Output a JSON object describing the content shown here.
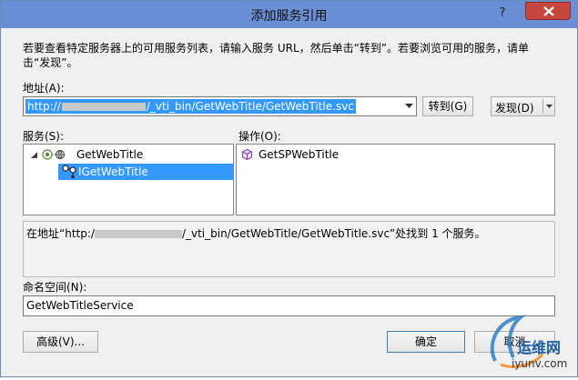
{
  "window": {
    "title": "添加服务引用",
    "help_label": "?"
  },
  "intro": {
    "text": "若要查看特定服务器上的可用服务列表，请输入服务 URL，然后单击“转到”。若要浏览可用的服务，请单击“发现”。"
  },
  "address": {
    "label": "地址(A):",
    "value_start": "http://",
    "value_end": "/_vti_bin/GetWebTitle/GetWebTitle.svc",
    "go_button": "转到(G)",
    "discover_button": "发现(D)"
  },
  "services": {
    "label": "服务(S):",
    "items": [
      {
        "label": "GetWebTitle",
        "level": 0,
        "expanded": true
      },
      {
        "label": "IGetWebTitle",
        "level": 1,
        "selected": true
      }
    ]
  },
  "operations": {
    "label": "操作(O):",
    "items": [
      {
        "label": "GetSPWebTitle"
      }
    ]
  },
  "status": {
    "text_start": "在地址“http:/",
    "text_end": "/_vti_bin/GetWebTitle/GetWebTitle.svc”处找到 1 个服务。"
  },
  "namespace": {
    "label": "命名空间(N):",
    "value": "GetWebTitleService"
  },
  "footer": {
    "advanced_button": "高级(V)...",
    "ok_button": "确定",
    "cancel_button": "取消"
  },
  "watermark": {
    "text_cn": "运维网",
    "text_url": "iyunv.com"
  },
  "colors": {
    "titlebar": "#6b8fd6",
    "close": "#c7463e",
    "selection": "#3399ff"
  }
}
